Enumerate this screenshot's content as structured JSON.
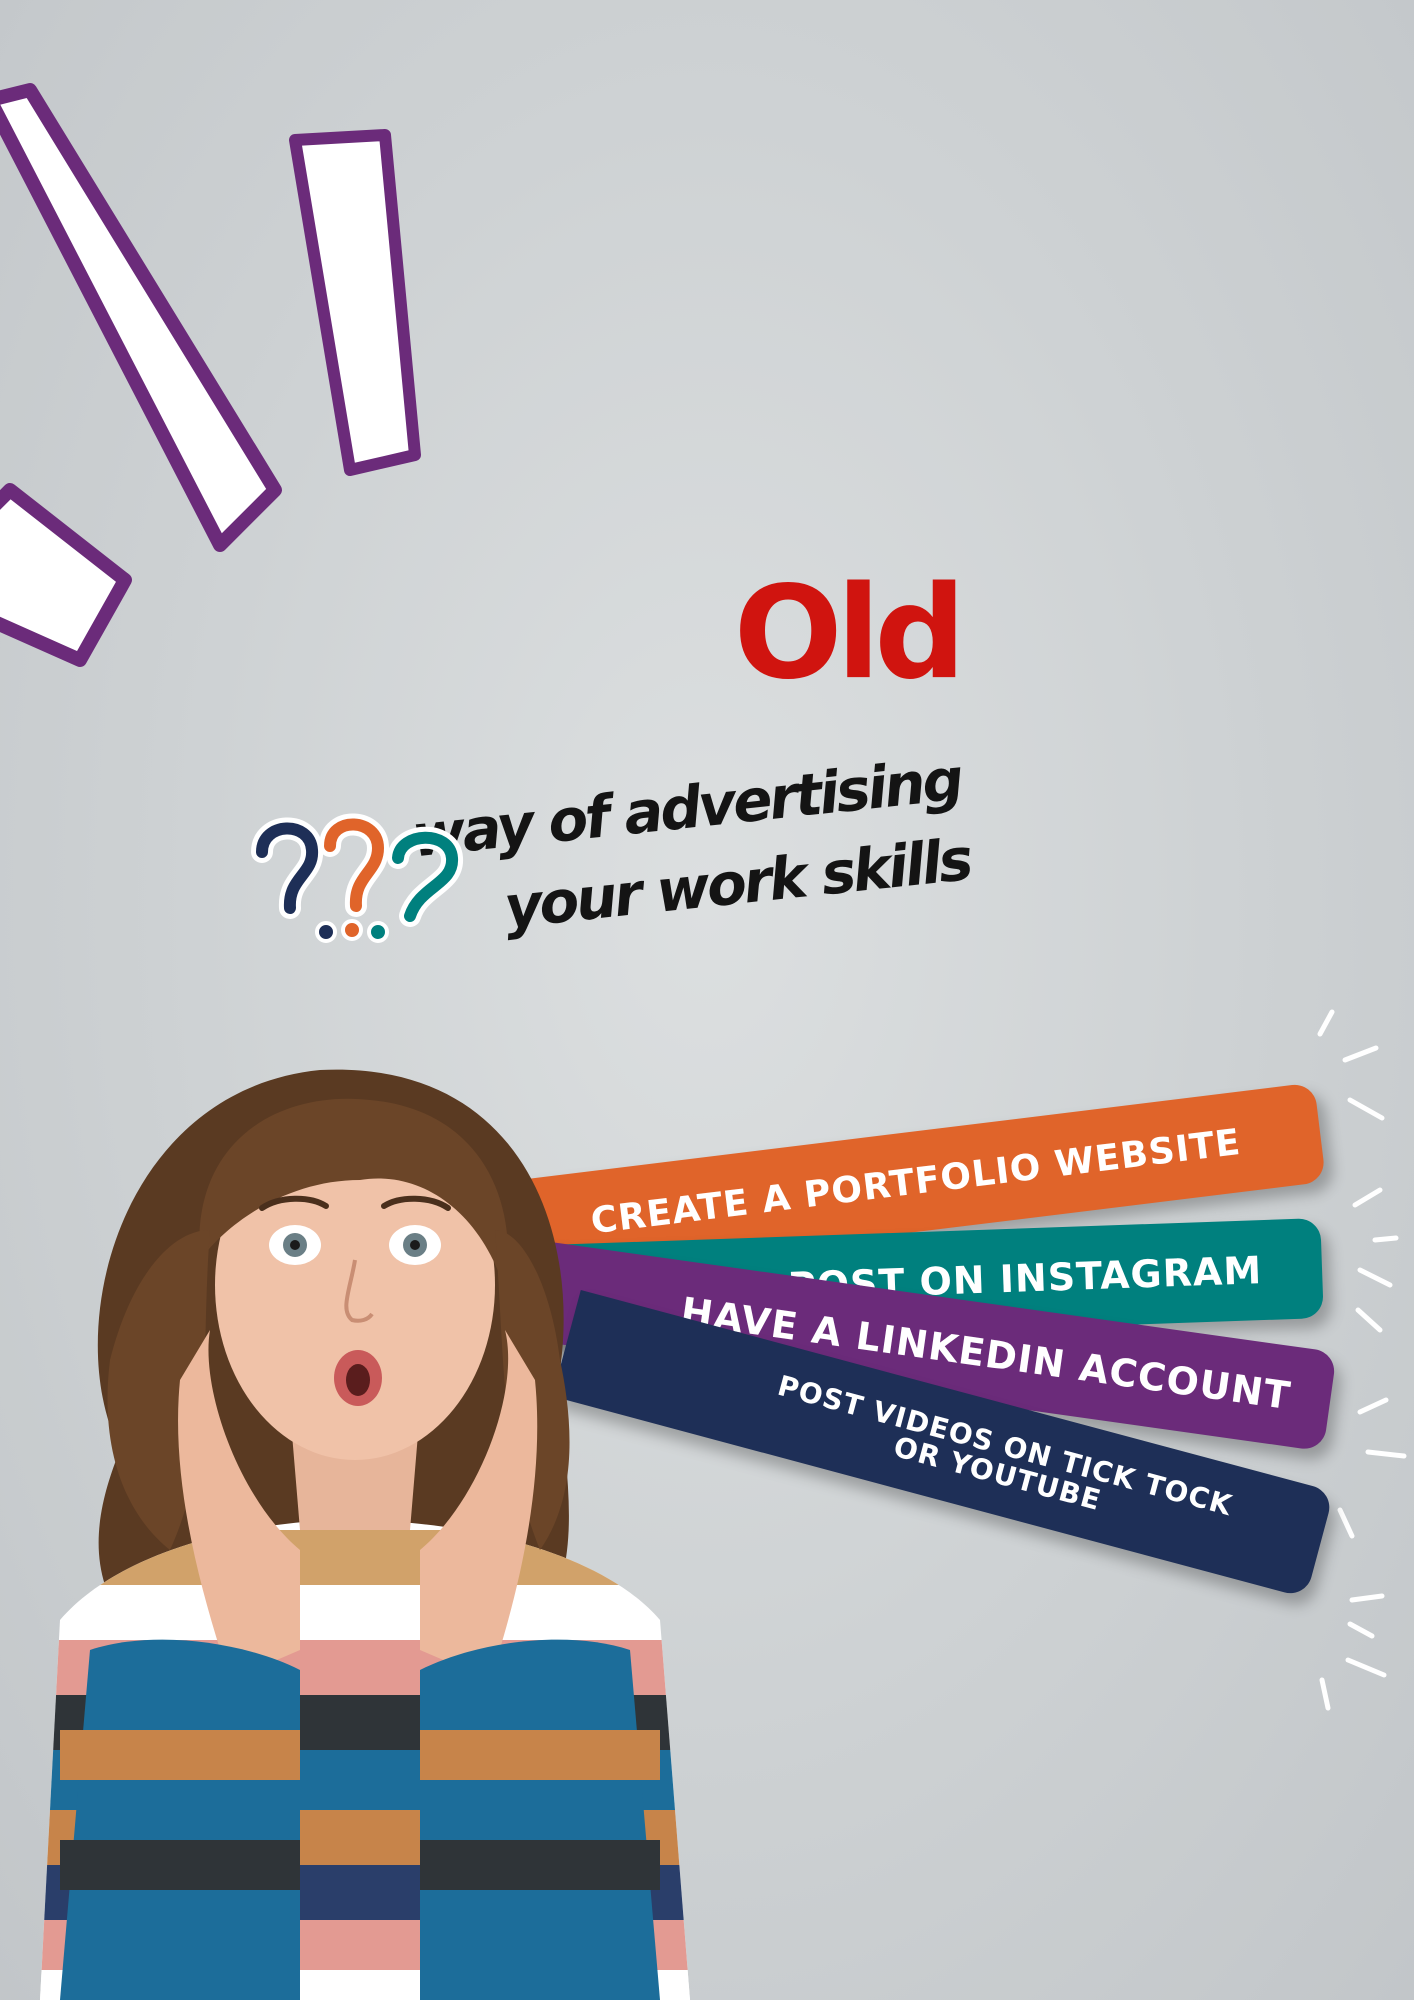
{
  "headline": {
    "emphasis": "Old",
    "line1": "way of advertising",
    "line2": "your work skills"
  },
  "options": [
    {
      "label": "CREATE A PORTFOLIO WEBSITE",
      "color": "#e0642a"
    },
    {
      "label": "POST ON INSTAGRAM",
      "color": "#00807e"
    },
    {
      "label": "HAVE A LINKEDIN ACCOUNT",
      "color": "#6b2b7a"
    },
    {
      "label": "POST VIDEOS ON TICK TOCK OR YOUTUBE",
      "color": "#1e2f57"
    }
  ],
  "colors": {
    "accent_red": "#d0140f",
    "purple": "#6b2b7a",
    "background": "#cdd1d3"
  },
  "decorations": {
    "question_marks_icon": "question-marks-icon",
    "exclamation_strokes_icon": "exclamation-strokes-icon",
    "woman_image": "surprised-woman-photo"
  }
}
